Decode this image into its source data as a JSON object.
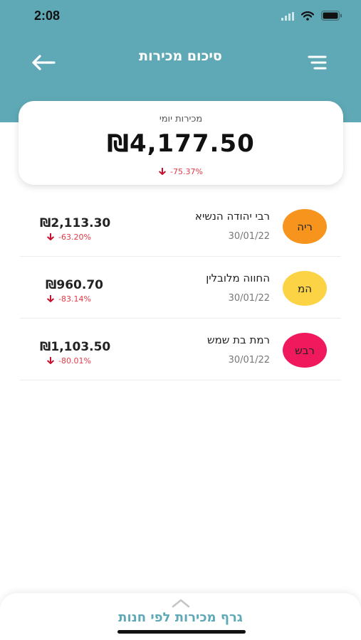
{
  "status_bar": {
    "time": "2:08"
  },
  "header": {
    "title": "סיכום מכירות"
  },
  "summary": {
    "label": "מכירות יומי",
    "amount": "₪4,177.50",
    "change": "-75.37%"
  },
  "stores": [
    {
      "initials": "ריה",
      "name": "רבי יהודה הנשיא",
      "date": "30/01/22",
      "amount": "₪2,113.30",
      "change": "-63.20%",
      "color": "#f7941d"
    },
    {
      "initials": "המ",
      "name": "החווה מלובלין",
      "date": "30/01/22",
      "amount": "₪960.70",
      "change": "-83.14%",
      "color": "#fcd344"
    },
    {
      "initials": "רבש",
      "name": "רמת בת שמש",
      "date": "30/01/22",
      "amount": "₪1,103.50",
      "change": "-80.01%",
      "color": "#f0195e"
    }
  ],
  "bottom_sheet": {
    "label": "גרף מכירות לפי חנות"
  },
  "colors": {
    "header": "#5fa9b6",
    "negative": "#e53946"
  },
  "icons": [
    "back-arrow-icon",
    "menu-icon",
    "down-arrow-icon",
    "chevron-up-icon",
    "wifi-icon",
    "battery-icon",
    "signal-icon"
  ]
}
